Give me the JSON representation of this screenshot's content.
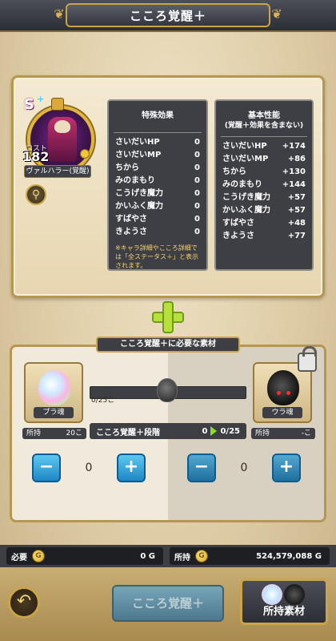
{
  "header": {
    "title": "こころ覚醒＋"
  },
  "character": {
    "rank": "S",
    "cost_label": "コスト",
    "cost": "182",
    "name": "ヴァルハラー(覚醒)"
  },
  "special_effects": {
    "title": "特殊効果",
    "rows": [
      {
        "label": "さいだいHP",
        "value": "0"
      },
      {
        "label": "さいだいMP",
        "value": "0"
      },
      {
        "label": "ちから",
        "value": "0"
      },
      {
        "label": "みのまもり",
        "value": "0"
      },
      {
        "label": "こうげき魔力",
        "value": "0"
      },
      {
        "label": "かいふく魔力",
        "value": "0"
      },
      {
        "label": "すばやさ",
        "value": "0"
      },
      {
        "label": "きようさ",
        "value": "0"
      }
    ],
    "note": "※キャラ詳細やこころ詳細では「全ステータス＋」と表示されます。"
  },
  "base_stats": {
    "title": "基本性能",
    "subtitle": "(覚醒＋効果を含まない)",
    "rows": [
      {
        "label": "さいだいHP",
        "value": "+174"
      },
      {
        "label": "さいだいMP",
        "value": "+86"
      },
      {
        "label": "ちから",
        "value": "+130"
      },
      {
        "label": "みのまもり",
        "value": "+144"
      },
      {
        "label": "こうげき魔力",
        "value": "+57"
      },
      {
        "label": "かいふく魔力",
        "value": "+57"
      },
      {
        "label": "すばやさ",
        "value": "+48"
      },
      {
        "label": "きようさ",
        "value": "+77"
      }
    ]
  },
  "materials": {
    "title": "こころ覚醒＋に必要な素材",
    "left": {
      "name": "プラ魂",
      "owned_label": "所持",
      "owned_value": "20こ",
      "count": "0"
    },
    "right": {
      "name": "ウラ魂",
      "owned_label": "所持",
      "owned_value": "-こ",
      "count": "0"
    },
    "progress_text": "0/25こ",
    "progress_fraction": 0,
    "step": {
      "label": "こころ覚醒＋段階",
      "from": "0",
      "to": "0/25"
    }
  },
  "status": {
    "need_label": "必要",
    "need_value": "0 G",
    "have_label": "所持",
    "have_value": "524,579,088 G",
    "coin_glyph": "G"
  },
  "footer": {
    "main_button": "こころ覚醒＋",
    "owned_button": "所持素材"
  },
  "colors": {
    "accent_gold": "#c9a44a",
    "button_blue": "#1e86c5",
    "plus_green": "#b7e13a"
  }
}
